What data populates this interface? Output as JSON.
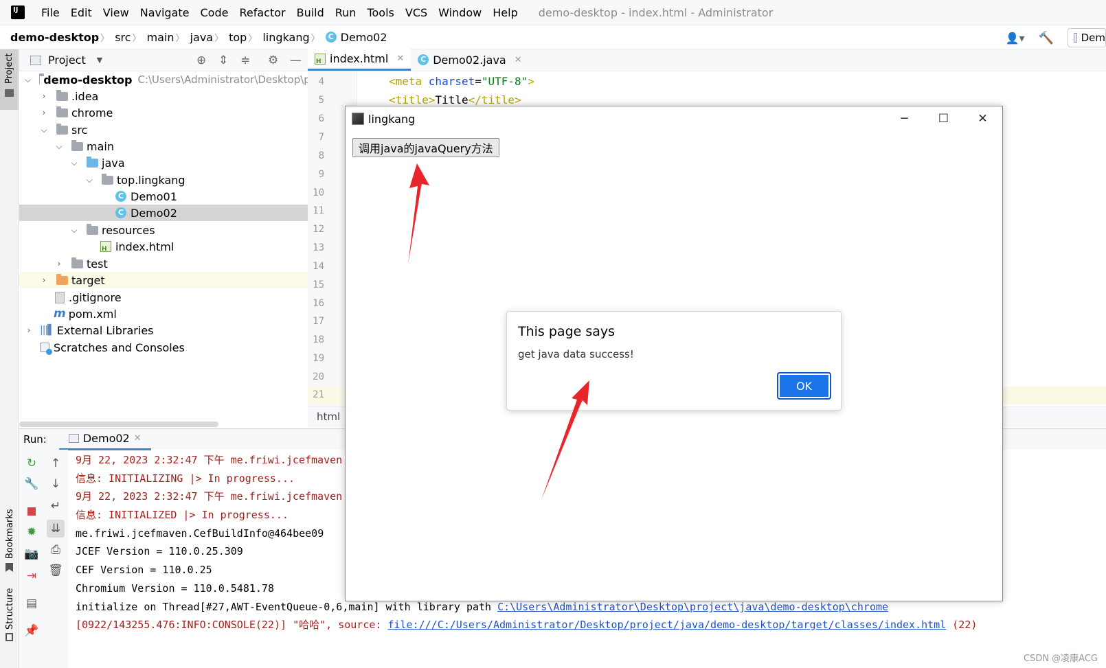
{
  "menubar": {
    "items": [
      "File",
      "Edit",
      "View",
      "Navigate",
      "Code",
      "Refactor",
      "Build",
      "Run",
      "Tools",
      "VCS",
      "Window",
      "Help"
    ],
    "window_title": "demo-desktop - index.html - Administrator"
  },
  "breadcrumb": {
    "items": [
      "demo-desktop",
      "src",
      "main",
      "java",
      "top",
      "lingkang",
      "Demo02"
    ],
    "run_config": "Dem"
  },
  "project_panel": {
    "title": "Project",
    "root_path": "C:\\Users\\Administrator\\Desktop\\pr",
    "tree": [
      {
        "label": "demo-desktop",
        "icon": "module-folder-icon",
        "expanded": true
      },
      {
        "label": ".idea",
        "icon": "folder-icon",
        "expanded": false
      },
      {
        "label": "chrome",
        "icon": "folder-icon",
        "expanded": false
      },
      {
        "label": "src",
        "icon": "folder-icon",
        "expanded": true
      },
      {
        "label": "main",
        "icon": "folder-icon",
        "expanded": true
      },
      {
        "label": "java",
        "icon": "source-folder-icon",
        "expanded": true
      },
      {
        "label": "top.lingkang",
        "icon": "package-icon",
        "expanded": true
      },
      {
        "label": "Demo01",
        "icon": "class-icon"
      },
      {
        "label": "Demo02",
        "icon": "class-icon",
        "selected": true
      },
      {
        "label": "resources",
        "icon": "resources-folder-icon",
        "expanded": true
      },
      {
        "label": "index.html",
        "icon": "html-file-icon"
      },
      {
        "label": "test",
        "icon": "folder-icon",
        "expanded": false
      },
      {
        "label": "target",
        "icon": "excluded-folder-icon",
        "expanded": false
      },
      {
        "label": ".gitignore",
        "icon": "gitignore-file-icon"
      },
      {
        "label": "pom.xml",
        "icon": "maven-file-icon"
      },
      {
        "label": "External Libraries",
        "icon": "libraries-icon",
        "expanded": false
      },
      {
        "label": "Scratches and Consoles",
        "icon": "scratches-icon"
      }
    ]
  },
  "editor": {
    "tabs": [
      {
        "label": "index.html",
        "active": true
      },
      {
        "label": "Demo02.java",
        "active": false
      }
    ],
    "line_numbers": [
      "4",
      "5",
      "6",
      "7",
      "8",
      "9",
      "10",
      "11",
      "12",
      "13",
      "14",
      "15",
      "16",
      "17",
      "18",
      "19",
      "20",
      "21"
    ],
    "code_line4": {
      "tag_open": "<meta ",
      "attr": "charset",
      "eq": "=",
      "value": "\"UTF-8\"",
      "tag_close": ">"
    },
    "code_line5": {
      "tag_open": "<title>",
      "text": "Title",
      "tag_close": "</title>"
    },
    "status": "html"
  },
  "run_panel": {
    "label": "Run:",
    "tab": "Demo02",
    "console": [
      {
        "text": "9月 22, 2023 2:32:47 下午 me.friwi.jcefmaven",
        "style": "red"
      },
      {
        "text": "信息: INITIALIZING |> In progress...",
        "style": "red"
      },
      {
        "text": "9月 22, 2023 2:32:47 下午 me.friwi.jcefmaven",
        "style": "red"
      },
      {
        "text": "信息: INITIALIZED |> In progress...",
        "style": "red"
      },
      {
        "text": "me.friwi.jcefmaven.CefBuildInfo@464bee09",
        "style": "normal"
      },
      {
        "text": "JCEF Version = 110.0.25.309",
        "style": "normal"
      },
      {
        "text": "CEF Version = 110.0.25",
        "style": "normal"
      },
      {
        "text": "Chromium Version = 110.0.5481.78",
        "style": "normal"
      }
    ],
    "console_init_prefix": "initialize on Thread[#27,AWT-EventQueue-0,6,main] with library path ",
    "console_init_link": "C:\\Users\\Administrator\\Desktop\\project\\java\\demo-desktop\\chrome",
    "console_log_prefix": "[0922/143255.476:INFO:CONSOLE(22)] \"哈哈\", source: ",
    "console_log_link": "file:///C:/Users/Administrator/Desktop/project/java/demo-desktop/target/classes/index.html",
    "console_log_suffix": " (22)"
  },
  "side_strip": {
    "project": "Project",
    "bookmarks": "Bookmarks",
    "structure": "Structure"
  },
  "browser_window": {
    "title": "lingkang",
    "button_label": "调用java的javaQuery方法"
  },
  "alert": {
    "title": "This page says",
    "message": "get java data success!",
    "ok_label": "OK"
  },
  "watermark": "CSDN @凌康ACG",
  "colors": {
    "accent": "#4083c9",
    "ok_button": "#1a73e8",
    "annotation_arrow": "#e8262a",
    "console_red": "#a0201c"
  }
}
